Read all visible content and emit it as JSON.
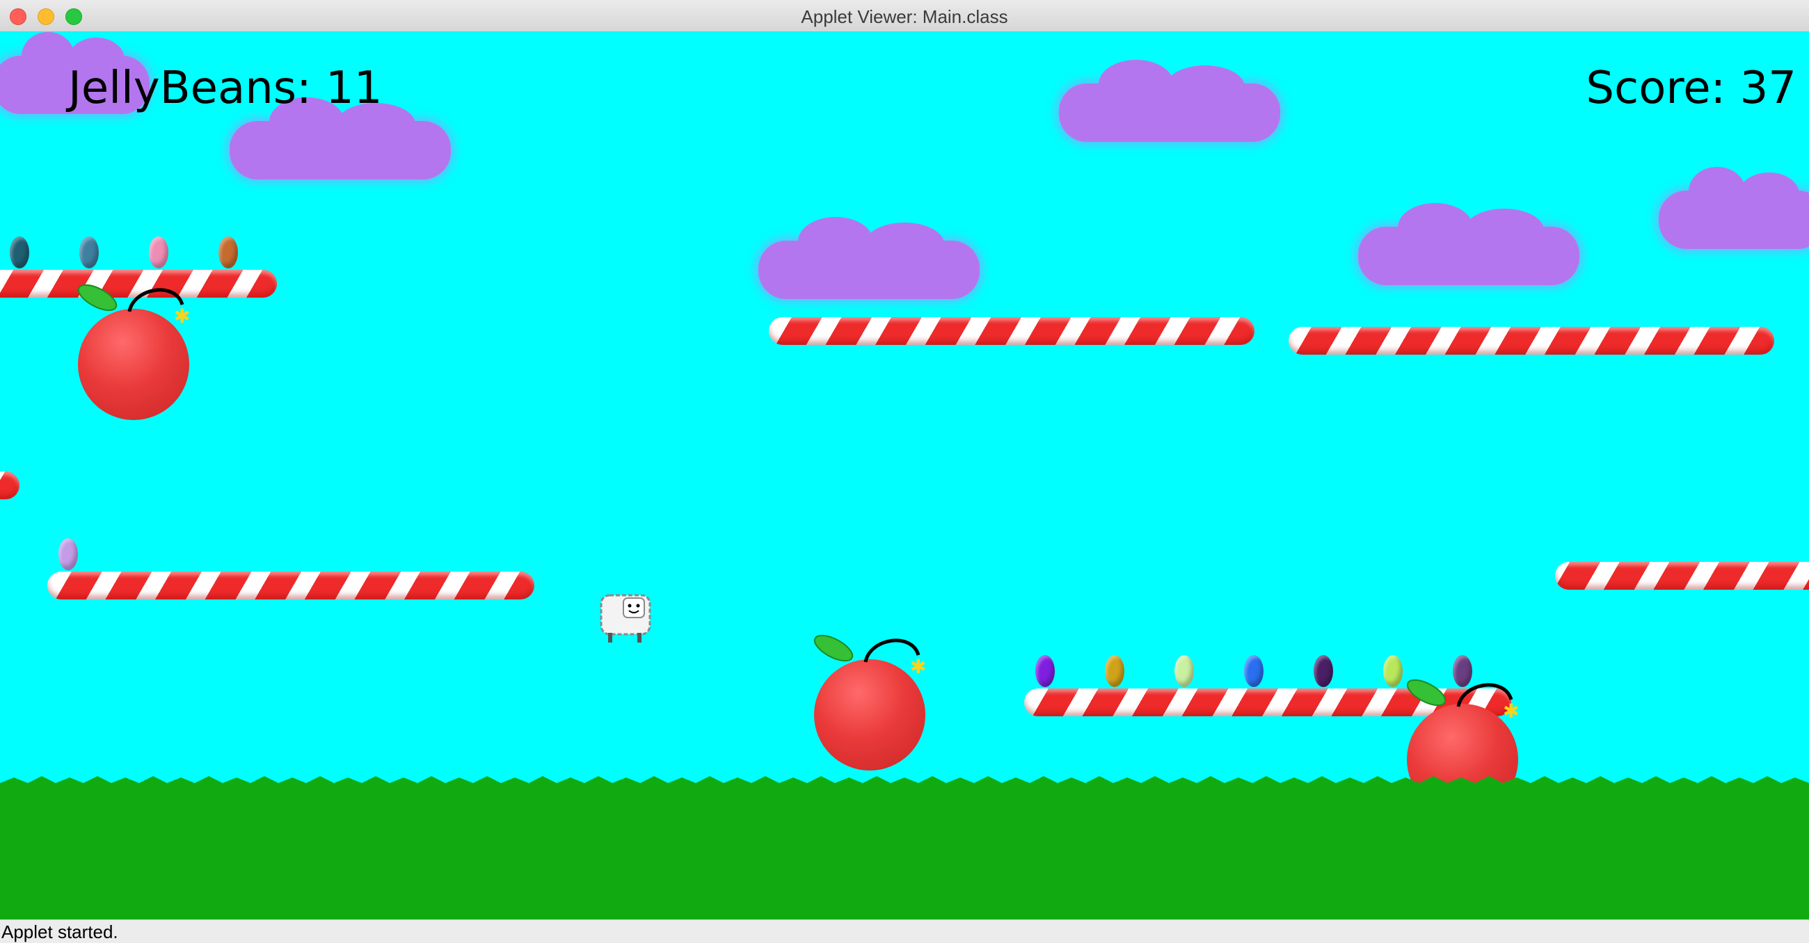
{
  "window": {
    "title": "Applet Viewer: Main.class",
    "buttons": [
      "close-button",
      "minimize-button",
      "zoom-button"
    ]
  },
  "hud": {
    "jellybeans_label": "JellyBeans: 11",
    "score_label": "Score: 37"
  },
  "status": {
    "text": "Applet started."
  },
  "colors": {
    "sky": "#00ffff",
    "grass": "#11ab11",
    "cloud": "#b476ee",
    "cane_red": "#ee2a2a",
    "bomb": "#ea3a3a"
  },
  "scene": {
    "player": "sheep",
    "hazards": [
      "cherry-bomb",
      "cherry-bomb",
      "cherry-bomb"
    ],
    "platforms": "candy-cane",
    "collectibles": "jelly-bean",
    "bean_colors": [
      "#1f5f73",
      "#3f7fa0",
      "#ee8db4",
      "#c46b2e",
      "#c39be6",
      "#7f1fe0",
      "#cfa21a",
      "#c8f0a0",
      "#2a6ff0",
      "#4a1f66",
      "#b8e85a",
      "#6a3f82"
    ]
  }
}
